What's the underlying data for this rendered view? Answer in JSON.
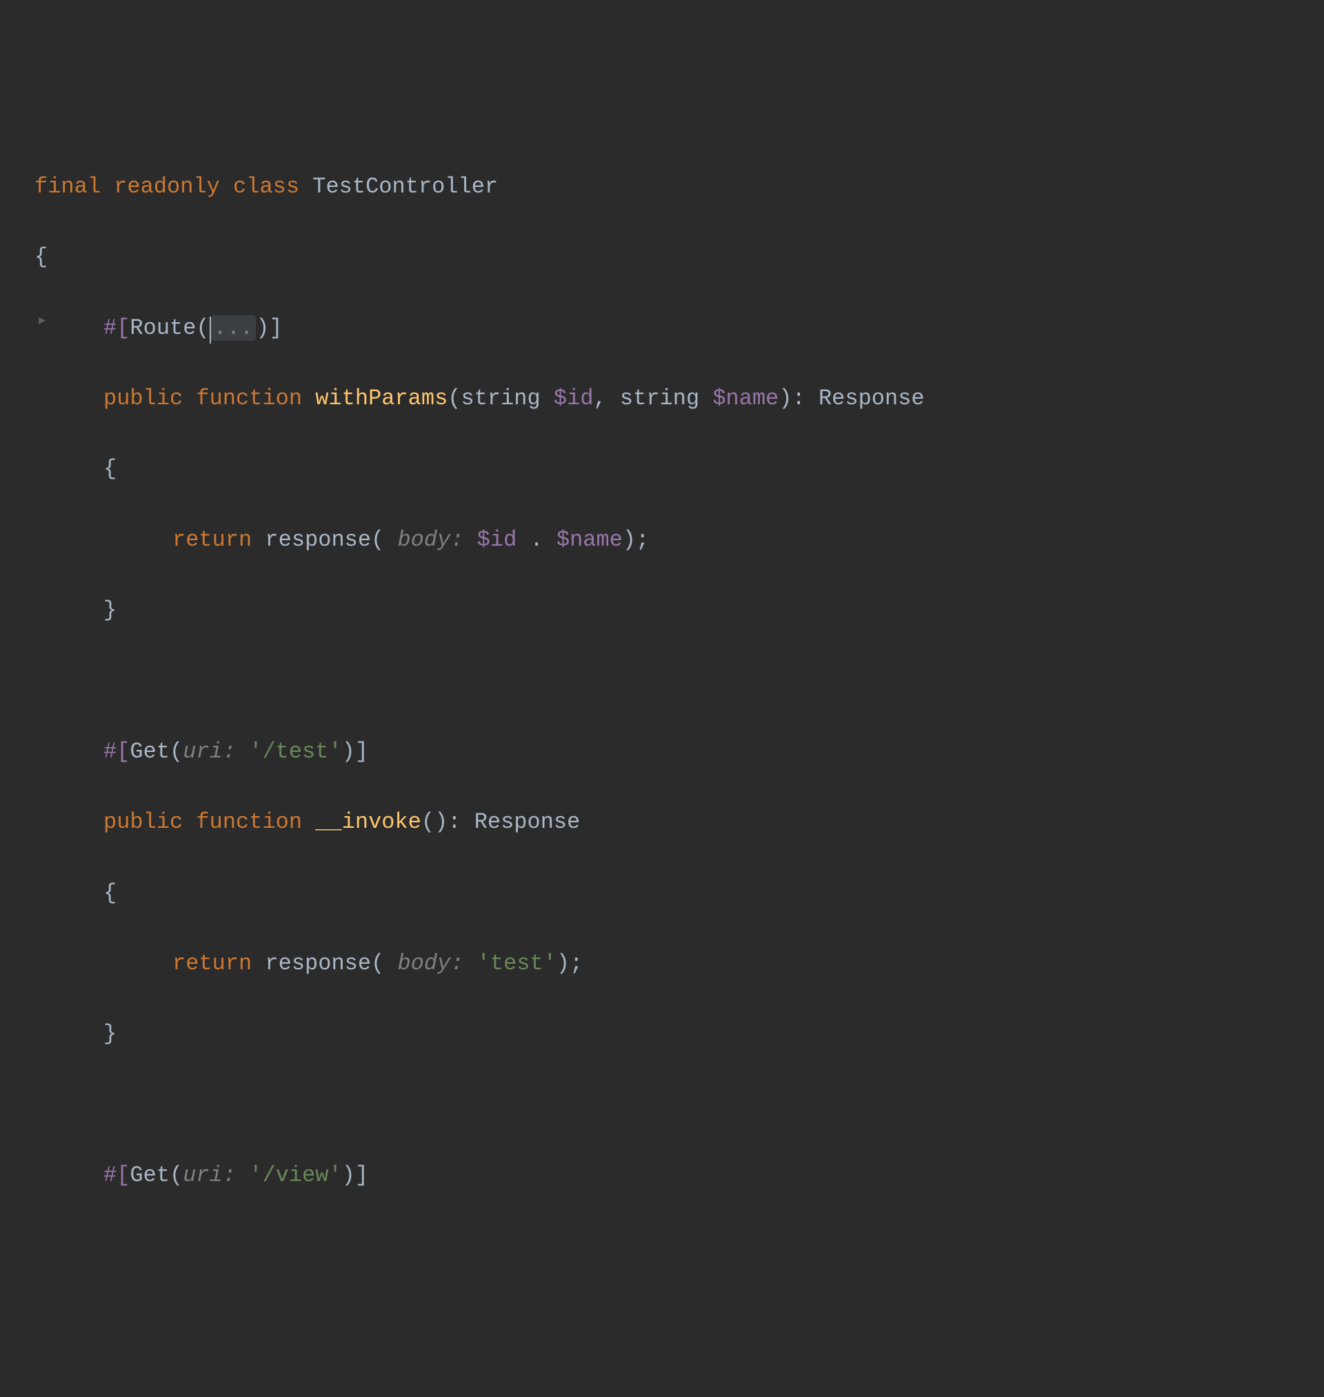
{
  "code": {
    "line1": {
      "final": "final",
      "readonly": "readonly",
      "class_kw": "class",
      "class_name": "TestController"
    },
    "line2": {
      "brace": "{"
    },
    "line3": {
      "hash": "#[",
      "route": "Route",
      "open": "(",
      "folded": "...",
      "close": ")]"
    },
    "line4": {
      "public": "public",
      "function": "function",
      "name": "withParams",
      "open": "(",
      "type1": "string",
      "var1": "$id",
      "comma": ",",
      "type2": "string",
      "var2": "$name",
      "close": "):",
      "return_type": "Response"
    },
    "line5": {
      "brace": "{"
    },
    "line6": {
      "return": "return",
      "func": "response",
      "open": "(",
      "hint": "body:",
      "var1": "$id",
      "concat": ".",
      "var2": "$name",
      "close": ");"
    },
    "line7": {
      "brace": "}"
    },
    "line8": {
      "hash": "#[",
      "get": "Get",
      "open": "(",
      "hint": "uri:",
      "string": "'/test'",
      "close": ")]"
    },
    "line9": {
      "public": "public",
      "function": "function",
      "name": "__invoke",
      "parens": "():",
      "return_type": "Response"
    },
    "line10": {
      "brace": "{"
    },
    "line11": {
      "return": "return",
      "func": "response",
      "open": "(",
      "hint": "body:",
      "string": "'test'",
      "close": ");"
    },
    "line12": {
      "brace": "}"
    },
    "line13": {
      "hash": "#[",
      "get": "Get",
      "open": "(",
      "hint": "uri:",
      "string": "'/view'",
      "close": ")]"
    }
  }
}
